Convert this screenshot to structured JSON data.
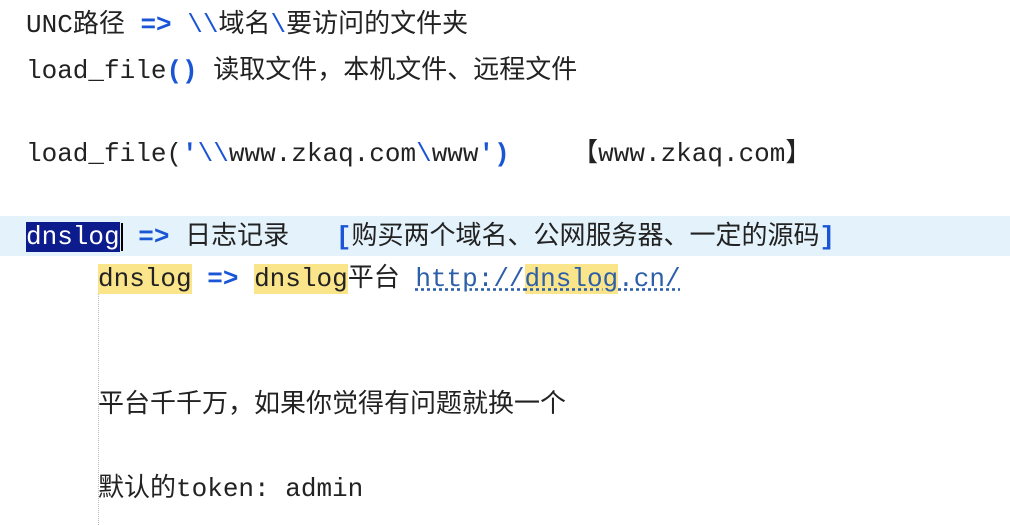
{
  "lines": [
    {
      "prefix": "UNC",
      "cjk1": "路径",
      "arrow": "=>",
      "path_prefix": "\\\\",
      "cjk2": "域名",
      "sep": "\\",
      "cjk3": "要访问的文件夹"
    },
    {
      "code": "load_file",
      "paren": "()",
      "cjk": "读取文件，本机文件、远程文件"
    },
    {
      "code_start": "load_file(",
      "quote_open": "'",
      "unc": "\\\\",
      "domain": "www.zkaq.com",
      "slash": "\\",
      "folder": "www",
      "quote_close": "'",
      "paren_close": ")",
      "bracket_text": "【www.zkaq.com】"
    },
    {
      "selected": "dnslog",
      "arrow": "=>",
      "cjk": "日志记录",
      "bracket_open": "[",
      "bracket_cjk": "购买两个域名、公网服务器、一定的源码",
      "bracket_close": "]"
    },
    {
      "hl1": "dnslog",
      "arrow": "=>",
      "hl2": "dnslog",
      "cjk": "平台",
      "link_prefix": "http://",
      "link_hl": "dnslog",
      "link_suffix": ".cn/"
    },
    {
      "cjk": "平台千千万，如果你觉得有问题就换一个"
    },
    {
      "cjk": "默认的",
      "code": "token: admin"
    }
  ],
  "colors": {
    "operator": "#1a55d6",
    "selection": "#0d1c8c",
    "highlight": "#fbe58a",
    "current_line": "#e4f2fb",
    "link": "#2c5fa8"
  }
}
